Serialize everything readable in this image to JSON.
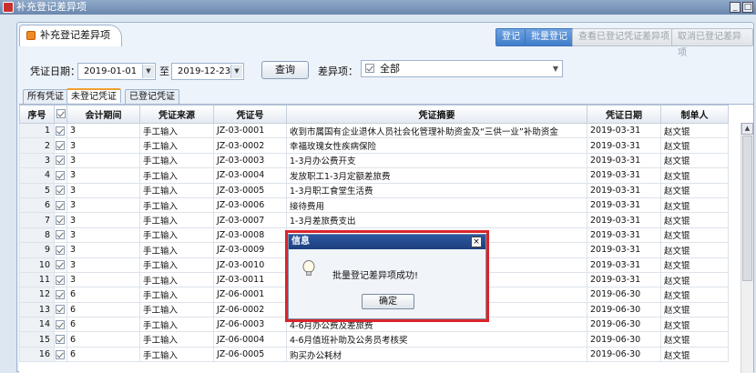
{
  "window": {
    "title": "补充登记差异项"
  },
  "panel": {
    "tab_label": "补充登记差异项"
  },
  "toolbar": {
    "register": "登记",
    "batch_register": "批量登记",
    "view_registered": "查看已登记凭证差异项",
    "cancel_registered": "取消已登记差异项"
  },
  "filter": {
    "date_label": "凭证日期：",
    "date_from": "2019-01-01",
    "to_label": "至",
    "date_to": "2019-12-23",
    "query_button": "查询",
    "diff_label": "差异项：",
    "diff_value": "全部"
  },
  "subtabs": [
    "所有凭证",
    "未登记凭证",
    "已登记凭证"
  ],
  "table": {
    "headers": [
      "序号",
      "",
      "会计期间",
      "凭证来源",
      "凭证号",
      "凭证摘要",
      "凭证日期",
      "制单人"
    ],
    "rows": [
      [
        "1",
        "3",
        "手工输入",
        "JZ-03-0001",
        "收到市属国有企业退休人员社会化管理补助资金及“三供一业”补助资金",
        "2019-03-31",
        "赵文锟"
      ],
      [
        "2",
        "3",
        "手工输入",
        "JZ-03-0002",
        "幸福玫瑰女性疾病保险",
        "2019-03-31",
        "赵文锟"
      ],
      [
        "3",
        "3",
        "手工输入",
        "JZ-03-0003",
        "1-3月办公费开支",
        "2019-03-31",
        "赵文锟"
      ],
      [
        "4",
        "3",
        "手工输入",
        "JZ-03-0004",
        "发放职工1-3月定额差旅费",
        "2019-03-31",
        "赵文锟"
      ],
      [
        "5",
        "3",
        "手工输入",
        "JZ-03-0005",
        "1-3月职工食堂生活费",
        "2019-03-31",
        "赵文锟"
      ],
      [
        "6",
        "3",
        "手工输入",
        "JZ-03-0006",
        "接待费用",
        "2019-03-31",
        "赵文锟"
      ],
      [
        "7",
        "3",
        "手工输入",
        "JZ-03-0007",
        "1-3月差旅费支出",
        "2019-03-31",
        "赵文锟"
      ],
      [
        "8",
        "3",
        "手工输入",
        "JZ-03-0008",
        "",
        "2019-03-31",
        "赵文锟"
      ],
      [
        "9",
        "3",
        "手工输入",
        "JZ-03-0009",
        "",
        "2019-03-31",
        "赵文锟"
      ],
      [
        "10",
        "3",
        "手工输入",
        "JZ-03-0010",
        "",
        "2019-03-31",
        "赵文锟"
      ],
      [
        "11",
        "3",
        "手工输入",
        "JZ-03-0011",
        "",
        "2019-03-31",
        "赵文锟"
      ],
      [
        "12",
        "6",
        "手工输入",
        "JZ-06-0001",
        "",
        "2019-06-30",
        "赵文锟"
      ],
      [
        "13",
        "6",
        "手工输入",
        "JZ-06-0002",
        "",
        "2019-06-30",
        "赵文锟"
      ],
      [
        "14",
        "6",
        "手工输入",
        "JZ-06-0003",
        "4-6月办公费及差旅费",
        "2019-06-30",
        "赵文锟"
      ],
      [
        "15",
        "6",
        "手工输入",
        "JZ-06-0004",
        "4-6月值班补助及公务员考核奖",
        "2019-06-30",
        "赵文锟"
      ],
      [
        "16",
        "6",
        "手工输入",
        "JZ-06-0005",
        "购买办公耗材",
        "2019-06-30",
        "赵文锟"
      ]
    ]
  },
  "dialog": {
    "title": "信息",
    "message": "批量登记差异项成功!",
    "ok": "确定",
    "close": "×"
  }
}
